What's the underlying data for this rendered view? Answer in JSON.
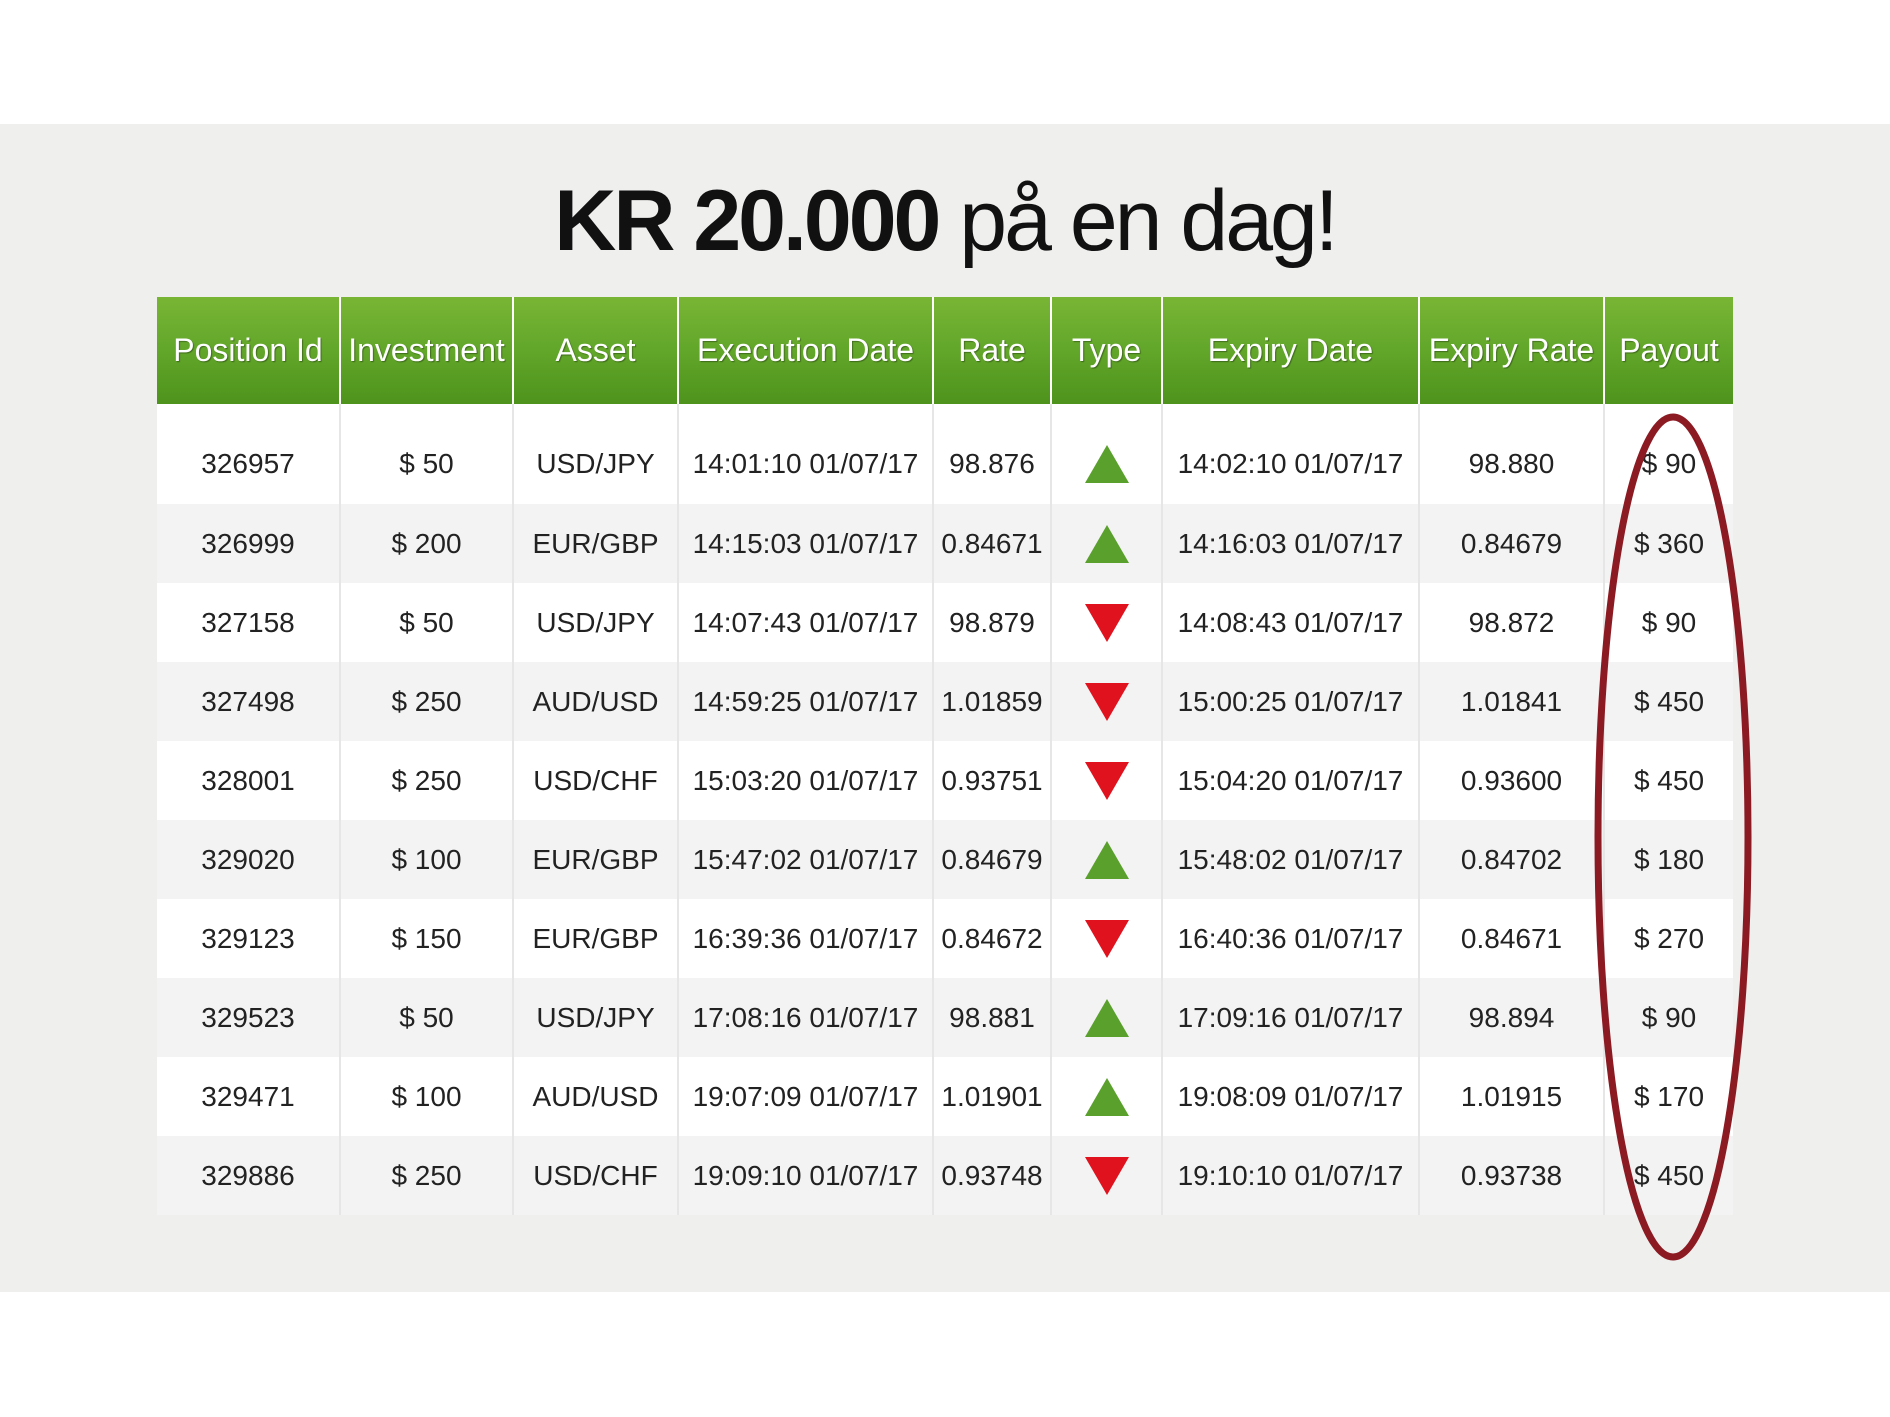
{
  "headline": {
    "bold": "KR 20.000",
    "rest": "på en dag!"
  },
  "table": {
    "columns": [
      "Position Id",
      "Investment",
      "Asset",
      "Execution Date",
      "Rate",
      "Type",
      "Expiry Date",
      "Expiry Rate",
      "Payout"
    ],
    "rows": [
      {
        "id": "326957",
        "investment": "$ 50",
        "asset": "USD/JPY",
        "execution": "14:01:10 01/07/17",
        "rate": "98.876",
        "type": "up-arrow-icon",
        "expiry": "14:02:10 01/07/17",
        "expiry_rate": "98.880",
        "payout": "$ 90"
      },
      {
        "id": "326999",
        "investment": "$ 200",
        "asset": "EUR/GBP",
        "execution": "14:15:03 01/07/17",
        "rate": "0.84671",
        "type": "up-arrow-icon",
        "expiry": "14:16:03 01/07/17",
        "expiry_rate": "0.84679",
        "payout": "$ 360"
      },
      {
        "id": "327158",
        "investment": "$ 50",
        "asset": "USD/JPY",
        "execution": "14:07:43 01/07/17",
        "rate": "98.879",
        "type": "down-arrow-icon",
        "expiry": "14:08:43 01/07/17",
        "expiry_rate": "98.872",
        "payout": "$ 90"
      },
      {
        "id": "327498",
        "investment": "$ 250",
        "asset": "AUD/USD",
        "execution": "14:59:25 01/07/17",
        "rate": "1.01859",
        "type": "down-arrow-icon",
        "expiry": "15:00:25 01/07/17",
        "expiry_rate": "1.01841",
        "payout": "$ 450"
      },
      {
        "id": "328001",
        "investment": "$ 250",
        "asset": "USD/CHF",
        "execution": "15:03:20 01/07/17",
        "rate": "0.93751",
        "type": "down-arrow-icon",
        "expiry": "15:04:20 01/07/17",
        "expiry_rate": "0.93600",
        "payout": "$ 450"
      },
      {
        "id": "329020",
        "investment": "$ 100",
        "asset": "EUR/GBP",
        "execution": "15:47:02 01/07/17",
        "rate": "0.84679",
        "type": "up-arrow-icon",
        "expiry": "15:48:02 01/07/17",
        "expiry_rate": "0.84702",
        "payout": "$ 180"
      },
      {
        "id": "329123",
        "investment": "$ 150",
        "asset": "EUR/GBP",
        "execution": "16:39:36 01/07/17",
        "rate": "0.84672",
        "type": "down-arrow-icon",
        "expiry": "16:40:36 01/07/17",
        "expiry_rate": "0.84671",
        "payout": "$ 270"
      },
      {
        "id": "329523",
        "investment": "$ 50",
        "asset": "USD/JPY",
        "execution": "17:08:16 01/07/17",
        "rate": "98.881",
        "type": "up-arrow-icon",
        "expiry": "17:09:16 01/07/17",
        "expiry_rate": "98.894",
        "payout": "$ 90"
      },
      {
        "id": "329471",
        "investment": "$ 100",
        "asset": "AUD/USD",
        "execution": "19:07:09 01/07/17",
        "rate": "1.01901",
        "type": "up-arrow-icon",
        "expiry": "19:08:09 01/07/17",
        "expiry_rate": "1.01915",
        "payout": "$ 170"
      },
      {
        "id": "329886",
        "investment": "$ 250",
        "asset": "USD/CHF",
        "execution": "19:09:10 01/07/17",
        "rate": "0.93748",
        "type": "down-arrow-icon",
        "expiry": "19:10:10 01/07/17",
        "expiry_rate": "0.93738",
        "payout": "$ 450"
      }
    ]
  },
  "colors": {
    "header_green": "#64a82b",
    "up_green": "#5aa02c",
    "down_red": "#e0121e",
    "ring_dark_red": "#8b1a22",
    "panel_gray": "#efefee"
  }
}
